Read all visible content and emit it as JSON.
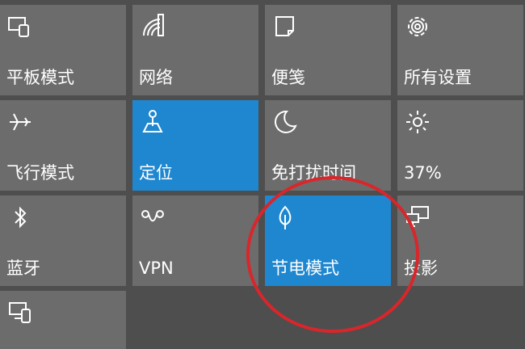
{
  "action_center": {
    "tiles": [
      {
        "id": "tablet-mode",
        "label": "平板模式",
        "icon": "tablet-mode-icon",
        "active": false
      },
      {
        "id": "network",
        "label": "网络",
        "icon": "network-icon",
        "active": false
      },
      {
        "id": "note",
        "label": "便笺",
        "icon": "note-icon",
        "active": false
      },
      {
        "id": "all-settings",
        "label": "所有设置",
        "icon": "gear-icon",
        "active": false
      },
      {
        "id": "airplane-mode",
        "label": "飞行模式",
        "icon": "airplane-icon",
        "active": false
      },
      {
        "id": "location",
        "label": "定位",
        "icon": "location-icon",
        "active": true
      },
      {
        "id": "quiet-hours",
        "label": "免打扰时间",
        "icon": "moon-icon",
        "active": false
      },
      {
        "id": "brightness",
        "label": "37%",
        "icon": "sun-icon",
        "active": false
      },
      {
        "id": "bluetooth",
        "label": "蓝牙",
        "icon": "bluetooth-icon",
        "active": false
      },
      {
        "id": "vpn",
        "label": "VPN",
        "icon": "vpn-icon",
        "active": false
      },
      {
        "id": "battery-saver",
        "label": "节电模式",
        "icon": "leaf-icon",
        "active": true
      },
      {
        "id": "project",
        "label": "投影",
        "icon": "project-icon",
        "active": false
      },
      {
        "id": "connect",
        "label": "",
        "icon": "connect-icon",
        "active": false
      }
    ]
  },
  "colors": {
    "tile_bg": "#6c6c6c",
    "tile_active": "#1e87d0",
    "background": "#4e4e4e",
    "annotation": "#d9262b"
  }
}
